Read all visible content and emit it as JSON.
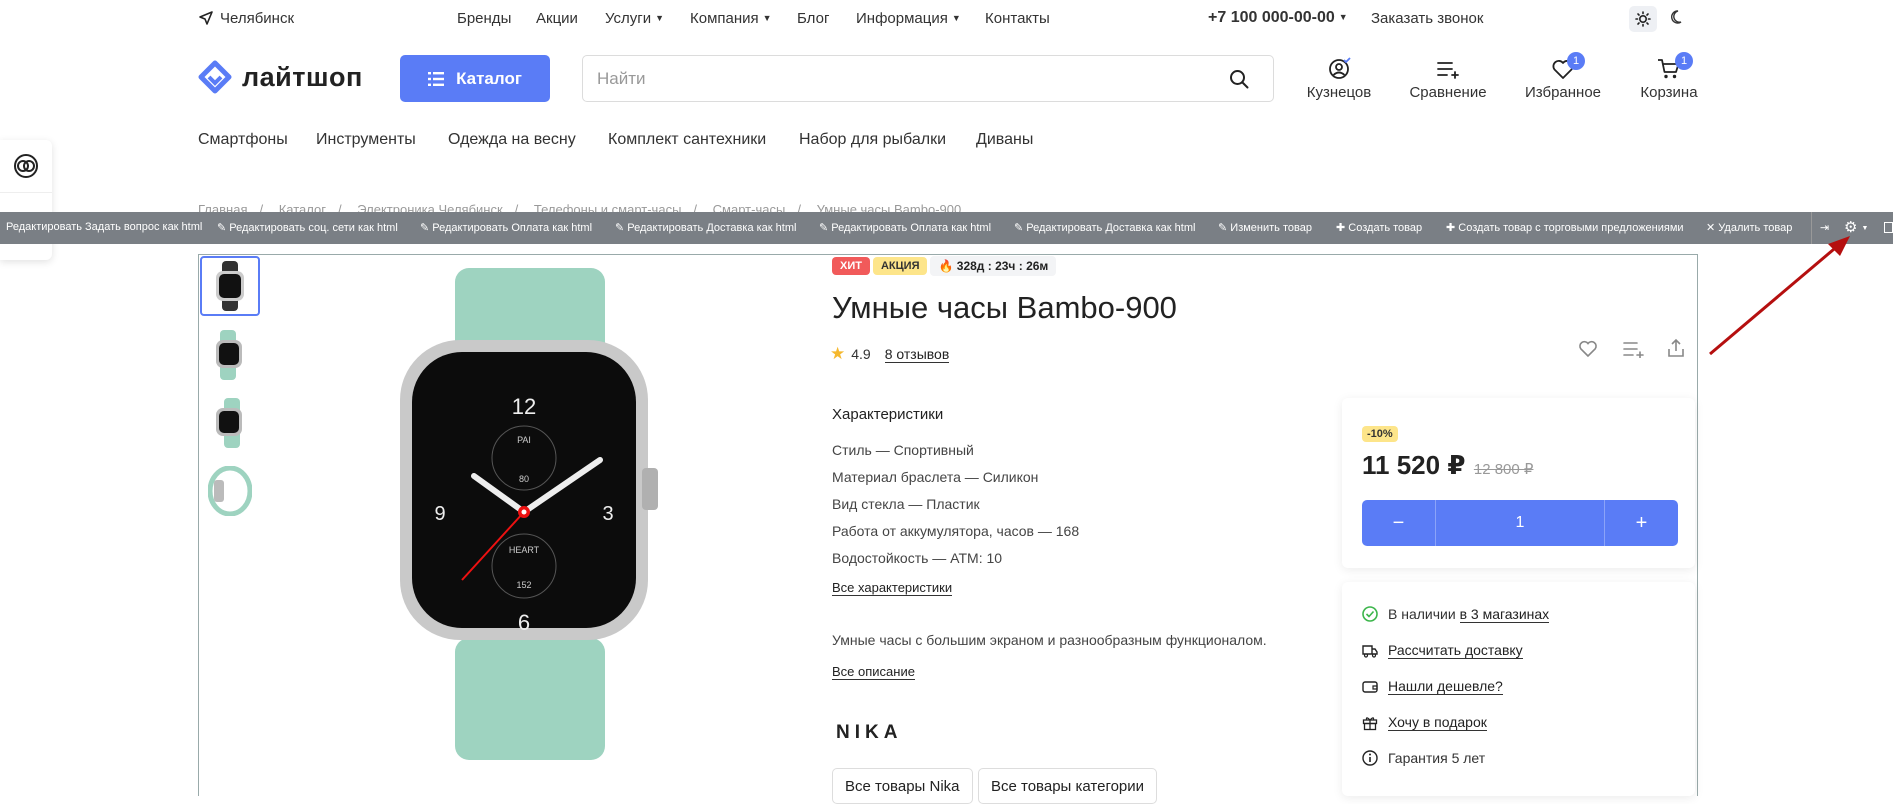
{
  "topbar": {
    "city": "Челябинск",
    "nav": [
      "Бренды",
      "Акции",
      "Услуги",
      "Компания",
      "Блог",
      "Информация",
      "Контакты"
    ],
    "phone": "+7 100 000-00-00",
    "callback": "Заказать звонок"
  },
  "header": {
    "logo": "лайтшоп",
    "catalog_label": "Каталог",
    "search_placeholder": "Найти",
    "actions": [
      {
        "label": "Кузнецов",
        "icon": "user-icon"
      },
      {
        "label": "Сравнение",
        "icon": "compare-icon"
      },
      {
        "label": "Избранное",
        "icon": "heart-icon",
        "badge": "1"
      },
      {
        "label": "Корзина",
        "icon": "cart-icon",
        "badge": "1"
      }
    ]
  },
  "catnav": [
    "Смартфоны",
    "Инструменты",
    "Одежда на весну",
    "Комплект сантехники",
    "Набор для рыбалки",
    "Диваны"
  ],
  "breadcrumb": [
    "Главная",
    "Каталог",
    "Электроника Челябинск",
    "Телефоны и смарт-часы",
    "Смарт-часы",
    "Умные часы Bambo-900"
  ],
  "adminbar": [
    "Редактировать Задать вопрос как html",
    "Редактировать соц. сети как html",
    "Редактировать Оплата как html",
    "Редактировать Доставка как html",
    "Редактировать Оплата как html",
    "Редактировать Доставка как html",
    "Изменить товар",
    "Создать товар",
    "Создать товар с торговыми предложениями",
    "Удалить товар"
  ],
  "product": {
    "tags": [
      "ХИТ",
      "АКЦИЯ"
    ],
    "timer": "328д : 23ч : 26м",
    "title": "Умные часы Bambo-900",
    "rating": "4.9",
    "reviews": "8 отзывов",
    "specs_title": "Характеристики",
    "specs": [
      "Стиль — Спортивный",
      "Материал браслета — Силикон",
      "Вид стекла — Пластик",
      "Работа от аккумулятора, часов — 168",
      "Водостойкость — ATM: 10"
    ],
    "all_specs": "Все характеристики",
    "description": "Умные часы с большим экраном и разнообразным функционалом.",
    "all_description": "Все описание",
    "brand": "NIKA",
    "chips": [
      "Все товары Nika",
      "Все товары категории"
    ],
    "watch_face": {
      "top": "12",
      "bottom": "6",
      "left": "9",
      "right": "3",
      "line1": "PAI",
      "line2": "80",
      "line3": "HEART",
      "line4": "152"
    }
  },
  "pricing": {
    "discount": "-10%",
    "price": "11 520 ₽",
    "old_price": "12 800 ₽",
    "qty": "1",
    "minus": "−",
    "plus": "+"
  },
  "info": {
    "stock_prefix": "В наличии",
    "stock_link": "в 3 магазинах",
    "delivery": "Рассчитать доставку",
    "cheaper": "Нашли дешевле?",
    "gift": "Хочу в подарок",
    "warranty": "Гарантия 5 лет"
  },
  "colors": {
    "accent": "#5a7cf6",
    "hit": "#f15a5a",
    "promo": "#fde58a",
    "adminbar": "#7a7f85"
  }
}
